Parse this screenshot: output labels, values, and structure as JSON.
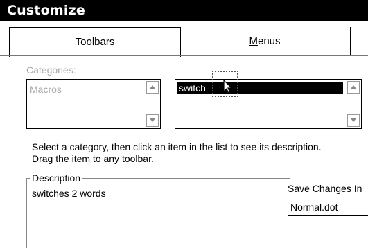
{
  "window": {
    "title": "Customize"
  },
  "tabs": [
    {
      "label": "Toolbars",
      "mnemonic": "T",
      "rest": "oolbars",
      "active": true
    },
    {
      "label": "Menus",
      "mnemonic": "M",
      "rest": "enus",
      "active": false
    }
  ],
  "categories": {
    "label": "Categories:",
    "items": [
      "Macros"
    ]
  },
  "commands": {
    "items": [
      "switch"
    ],
    "selected": "switch"
  },
  "help_text": {
    "line1": "Select a category, then click an item in the list to see its description.",
    "line2": "Drag the item to any toolbar."
  },
  "description": {
    "label": "Description",
    "text": "switches 2 words"
  },
  "save_changes": {
    "label_pre": "Sa",
    "label_mnemonic": "v",
    "label_post": "e Changes In",
    "value": "Normal.dot"
  },
  "icons": [
    "scroll-up-icon",
    "scroll-down-icon",
    "mouse-pointer-icon",
    "drag-outline-icon"
  ]
}
